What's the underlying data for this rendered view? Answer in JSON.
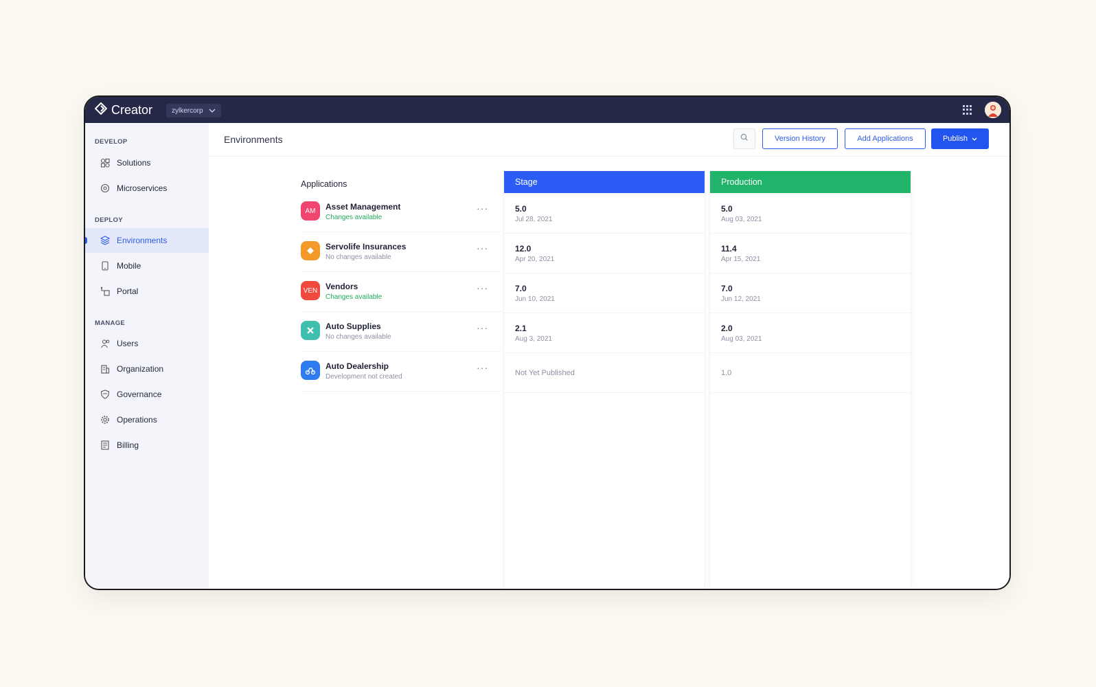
{
  "app": {
    "name": "Creator",
    "org": "zylkercorp"
  },
  "sidebar": {
    "sections": [
      {
        "label": "DEVELOP",
        "items": [
          {
            "label": "Solutions",
            "icon": "solutions-icon"
          },
          {
            "label": "Microservices",
            "icon": "microservices-icon"
          }
        ]
      },
      {
        "label": "DEPLOY",
        "items": [
          {
            "label": "Environments",
            "icon": "layers-icon",
            "active": true
          },
          {
            "label": "Mobile",
            "icon": "mobile-icon"
          },
          {
            "label": "Portal",
            "icon": "portal-icon"
          }
        ]
      },
      {
        "label": "MANAGE",
        "items": [
          {
            "label": "Users",
            "icon": "users-icon"
          },
          {
            "label": "Organization",
            "icon": "organization-icon"
          },
          {
            "label": "Governance",
            "icon": "governance-icon"
          },
          {
            "label": "Operations",
            "icon": "gear-icon"
          },
          {
            "label": "Billing",
            "icon": "billing-icon"
          }
        ]
      }
    ]
  },
  "header": {
    "title": "Environments",
    "version_history": "Version History",
    "add_applications": "Add Applications",
    "publish": "Publish"
  },
  "table": {
    "applications_label": "Applications",
    "stage_label": "Stage",
    "production_label": "Production",
    "colors": {
      "stage": "#2c5cf5",
      "production": "#1fb46a",
      "changes": "#21a95c",
      "nochanges": "#8d90a3"
    },
    "rows": [
      {
        "name": "Asset Management",
        "status": "Changes available",
        "status_type": "changes",
        "icon_text": "AM",
        "icon_color": "#f0456e",
        "stage_version": "5.0",
        "stage_date": "Jul 28, 2021",
        "prod_version": "5.0",
        "prod_date": "Aug 03, 2021"
      },
      {
        "name": "Servolife Insurances",
        "status": "No changes available",
        "status_type": "nochanges",
        "icon_text": "",
        "icon_color": "#f39a2b",
        "stage_version": "12.0",
        "stage_date": "Apr 20, 2021",
        "prod_version": "11.4",
        "prod_date": "Apr 15, 2021"
      },
      {
        "name": "Vendors",
        "status": "Changes available",
        "status_type": "changes",
        "icon_text": "VEN",
        "icon_color": "#ef4a3d",
        "stage_version": "7.0",
        "stage_date": "Jun 10, 2021",
        "prod_version": "7.0",
        "prod_date": "Jun 12, 2021"
      },
      {
        "name": "Auto Supplies",
        "status": "No changes available",
        "status_type": "nochanges",
        "icon_text": "",
        "icon_color": "#3fbfae",
        "stage_version": "2.1",
        "stage_date": "Aug 3, 2021",
        "prod_version": "2.0",
        "prod_date": "Aug 03, 2021"
      },
      {
        "name": "Auto Dealership",
        "status": "Development not created",
        "status_type": "nochanges",
        "icon_text": "",
        "icon_color": "#2f7bf0",
        "stage_plain": "Not Yet Published",
        "prod_plain": "1.0"
      }
    ]
  }
}
